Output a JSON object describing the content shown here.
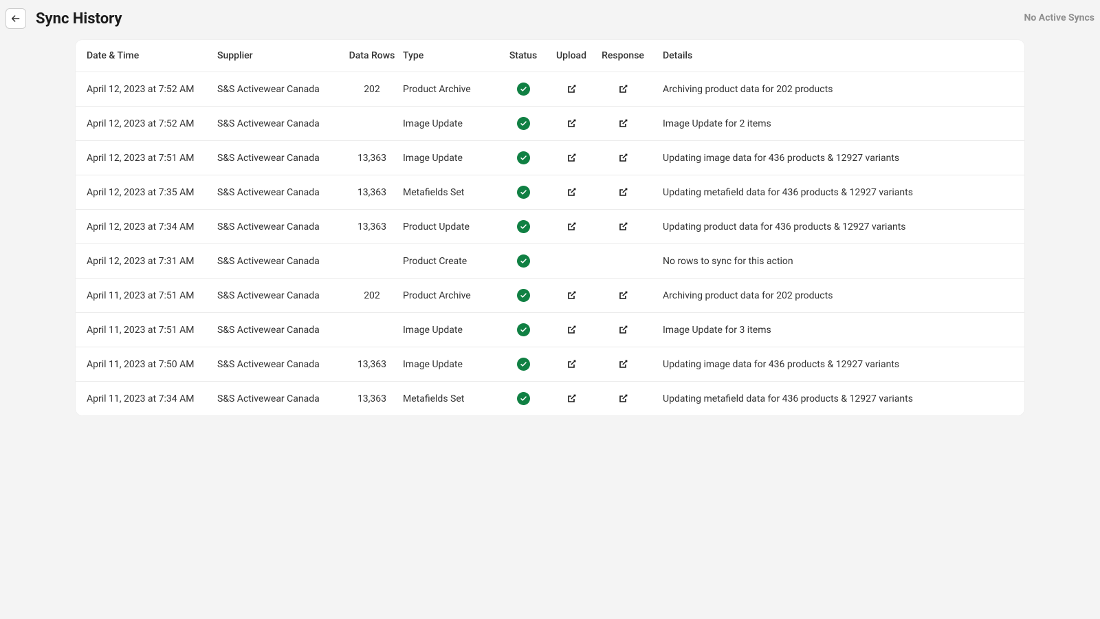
{
  "header": {
    "title": "Sync History",
    "status_text": "No Active Syncs"
  },
  "table": {
    "columns": {
      "datetime": "Date & Time",
      "supplier": "Supplier",
      "datarows": "Data Rows",
      "type": "Type",
      "status": "Status",
      "upload": "Upload",
      "response": "Response",
      "details": "Details"
    },
    "rows": [
      {
        "datetime": "April 12, 2023 at 7:52 AM",
        "supplier": "S&S Activewear Canada",
        "datarows": "202",
        "type": "Product Archive",
        "upload": true,
        "response": true,
        "details": "Archiving product data for 202 products"
      },
      {
        "datetime": "April 12, 2023 at 7:52 AM",
        "supplier": "S&S Activewear Canada",
        "datarows": "",
        "type": "Image Update",
        "upload": true,
        "response": true,
        "details": "Image Update for 2 items"
      },
      {
        "datetime": "April 12, 2023 at 7:51 AM",
        "supplier": "S&S Activewear Canada",
        "datarows": "13,363",
        "type": "Image Update",
        "upload": true,
        "response": true,
        "details": "Updating image data for 436 products & 12927 variants"
      },
      {
        "datetime": "April 12, 2023 at 7:35 AM",
        "supplier": "S&S Activewear Canada",
        "datarows": "13,363",
        "type": "Metafields Set",
        "upload": true,
        "response": true,
        "details": "Updating metafield data for 436 products & 12927 variants"
      },
      {
        "datetime": "April 12, 2023 at 7:34 AM",
        "supplier": "S&S Activewear Canada",
        "datarows": "13,363",
        "type": "Product Update",
        "upload": true,
        "response": true,
        "details": "Updating product data for 436 products & 12927 variants"
      },
      {
        "datetime": "April 12, 2023 at 7:31 AM",
        "supplier": "S&S Activewear Canada",
        "datarows": "",
        "type": "Product Create",
        "upload": false,
        "response": false,
        "details": "No rows to sync for this action"
      },
      {
        "datetime": "April 11, 2023 at 7:51 AM",
        "supplier": "S&S Activewear Canada",
        "datarows": "202",
        "type": "Product Archive",
        "upload": true,
        "response": true,
        "details": "Archiving product data for 202 products"
      },
      {
        "datetime": "April 11, 2023 at 7:51 AM",
        "supplier": "S&S Activewear Canada",
        "datarows": "",
        "type": "Image Update",
        "upload": true,
        "response": true,
        "details": "Image Update for 3 items"
      },
      {
        "datetime": "April 11, 2023 at 7:50 AM",
        "supplier": "S&S Activewear Canada",
        "datarows": "13,363",
        "type": "Image Update",
        "upload": true,
        "response": true,
        "details": "Updating image data for 436 products & 12927 variants"
      },
      {
        "datetime": "April 11, 2023 at 7:34 AM",
        "supplier": "S&S Activewear Canada",
        "datarows": "13,363",
        "type": "Metafields Set",
        "upload": true,
        "response": true,
        "details": "Updating metafield data for 436 products & 12927 variants"
      }
    ]
  }
}
